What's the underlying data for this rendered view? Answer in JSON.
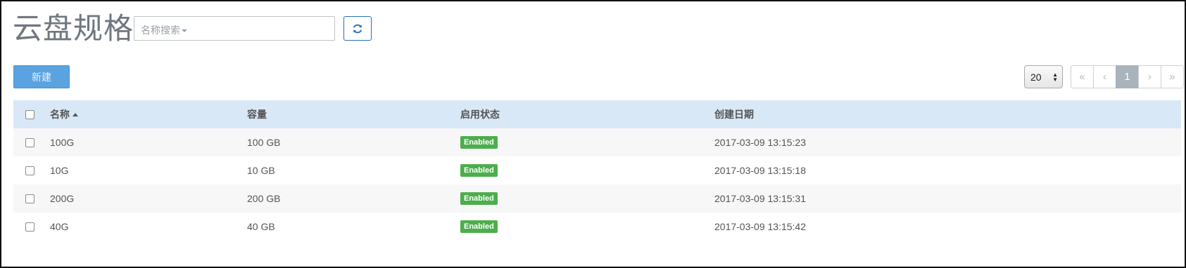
{
  "header": {
    "title": "云盘规格",
    "search_placeholder": "名称搜索",
    "refresh_icon": "refresh-icon"
  },
  "toolbar": {
    "new_label": "新建",
    "page_size": "20",
    "pager": {
      "first": "«",
      "prev": "‹",
      "current": "1",
      "next": "›",
      "last": "»"
    }
  },
  "table": {
    "columns": [
      "名称",
      "容量",
      "启用状态",
      "创建日期"
    ],
    "sort_column": "名称",
    "sort_direction": "asc",
    "rows": [
      {
        "name": "100G",
        "capacity": "100 GB",
        "status": "Enabled",
        "created": "2017-03-09 13:15:23"
      },
      {
        "name": "10G",
        "capacity": "10 GB",
        "status": "Enabled",
        "created": "2017-03-09 13:15:18"
      },
      {
        "name": "200G",
        "capacity": "200 GB",
        "status": "Enabled",
        "created": "2017-03-09 13:15:31"
      },
      {
        "name": "40G",
        "capacity": "40 GB",
        "status": "Enabled",
        "created": "2017-03-09 13:15:42"
      }
    ]
  },
  "colors": {
    "primary_button": "#5aa3e0",
    "header_row": "#d9e8f6",
    "badge_enabled": "#4cae4c",
    "refresh_border": "#2a6ebb"
  }
}
